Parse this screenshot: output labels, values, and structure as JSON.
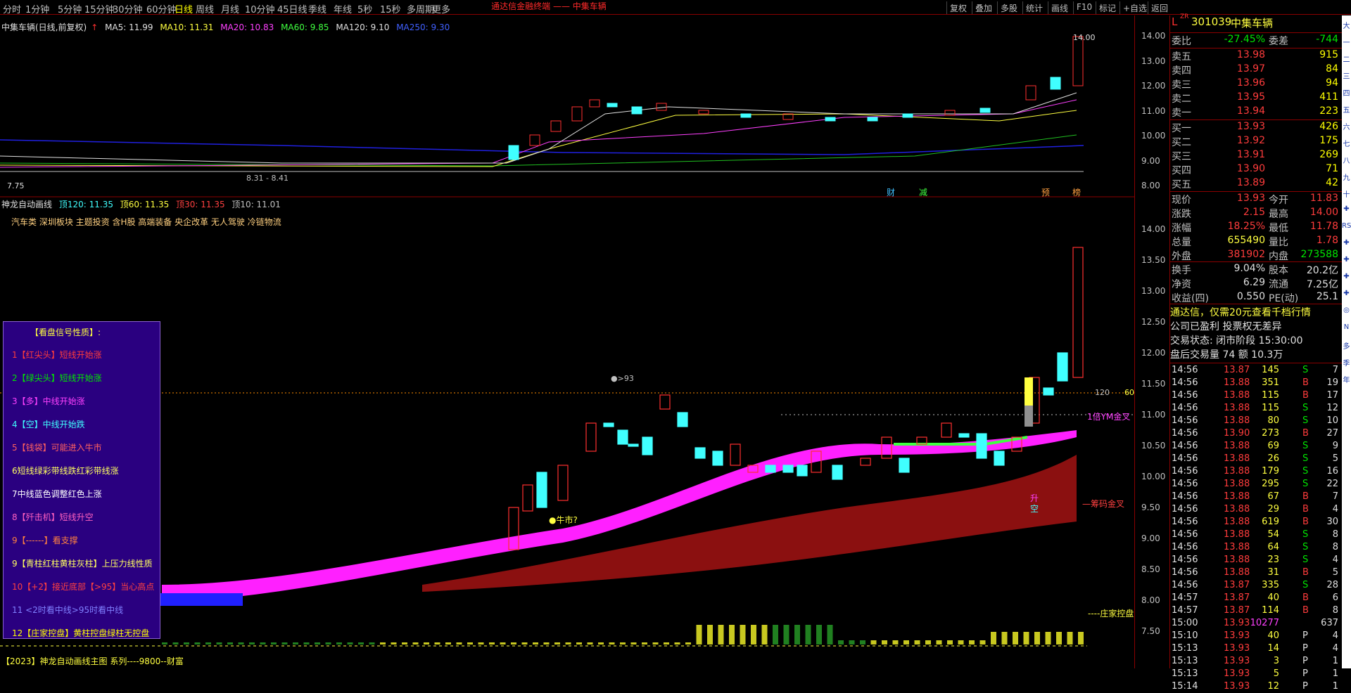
{
  "window_title": "通达信金融终端 —— 中集车辆",
  "timeframes": [
    "分时",
    "1分钟",
    "5分钟",
    "15分钟",
    "30分钟",
    "60分钟",
    "日线",
    "周线",
    "月线",
    "10分钟",
    "45日线",
    "季线",
    "年线",
    "5秒",
    "15秒",
    "多周期",
    "更多"
  ],
  "active_timeframe": "日线",
  "toolbar": [
    "复权",
    "叠加",
    "多股",
    "统计",
    "画线",
    "F10",
    "标记",
    "+自选",
    "返回"
  ],
  "stock": {
    "title": "中集车辆(日线,前复权)",
    "name": "中集车辆",
    "code": "301039",
    "badge": "ZR"
  },
  "ma": {
    "ma5": "MA5: 11.99",
    "ma10": "MA10: 11.31",
    "ma20": "MA20: 10.83",
    "ma60": "MA60: 9.85",
    "ma120": "MA120: 9.10",
    "ma250": "MA250: 9.30"
  },
  "upper_chart": {
    "high_label": "14.00",
    "low_label": "7.75",
    "range_label": "8.31 - 8.41",
    "event_marks": [
      "财",
      "减",
      "预",
      "榜"
    ]
  },
  "upper_axis": [
    "14.00",
    "13.00",
    "12.00",
    "11.00",
    "10.00",
    "9.00",
    "8.00"
  ],
  "lower_axis": [
    "14.00",
    "13.50",
    "13.00",
    "12.50",
    "12.00",
    "11.50",
    "11.00",
    "10.50",
    "10.00",
    "9.50",
    "9.00",
    "8.50",
    "8.00",
    "7.50"
  ],
  "indicator": {
    "name": "神龙自动画线",
    "vals": [
      "顶120: 11.35",
      "顶60: 11.35",
      "顶30: 11.35",
      "顶10: 11.01"
    ],
    "concepts": "汽车类 深圳板块 主题投资 含H股 高端装备 央企改革 无人驾驶 冷链物流",
    "labels": {
      "l120": "120",
      "l60": "60",
      "ym": "1倍YM金叉",
      "cm": "—筹码金叉",
      "zj": "----庄家控盘",
      "bull": "●牛市?",
      "gt93": "●>93",
      "sheng": "升",
      "kong": "空"
    }
  },
  "legend": {
    "title": "【看盘信号性质】:",
    "items": [
      {
        "t": "1【红尖头】短线开始涨",
        "c": "#ff3c3c"
      },
      {
        "t": "2【绿尖头】短线开始涨",
        "c": "#00e600"
      },
      {
        "t": "3【多】中线开始涨",
        "c": "#ff40ff"
      },
      {
        "t": "4【空】中线开始跌",
        "c": "#40ffff"
      },
      {
        "t": "5【钱袋】可能进入牛市",
        "c": "#ff6060"
      },
      {
        "t": "6短线绿彩带线跌红彩带线涨",
        "c": "#ffff60"
      },
      {
        "t": "7中线蓝色调整红色上涨",
        "c": "#ffffff"
      },
      {
        "t": "8【歼击机】短线升空",
        "c": "#ff60c0"
      },
      {
        "t": "9【------】看支撑",
        "c": "#ff8040"
      },
      {
        "t": "9【青柱红柱黄柱灰柱】上压力线性质",
        "c": "#ffff60"
      },
      {
        "t": "10【+2】接近底部【>95】当心高点",
        "c": "#ff4040"
      },
      {
        "t": "11 <2时看中线>95时看中线",
        "c": "#8080ff"
      },
      {
        "t": "12【庄家控盘】黄柱控盘绿柱无控盘",
        "c": "#ffff00"
      }
    ]
  },
  "footer": "【2023】神龙自动画线主图 系列----9800--财富",
  "quote": {
    "weibi": {
      "label": "委比",
      "value": "-27.45%",
      "label2": "委差",
      "value2": "-744"
    },
    "asks": [
      {
        "l": "卖五",
        "p": "13.98",
        "v": "915"
      },
      {
        "l": "卖四",
        "p": "13.97",
        "v": "84"
      },
      {
        "l": "卖三",
        "p": "13.96",
        "v": "94"
      },
      {
        "l": "卖二",
        "p": "13.95",
        "v": "411"
      },
      {
        "l": "卖一",
        "p": "13.94",
        "v": "223"
      }
    ],
    "bids": [
      {
        "l": "买一",
        "p": "13.93",
        "v": "426"
      },
      {
        "l": "买二",
        "p": "13.92",
        "v": "175"
      },
      {
        "l": "买三",
        "p": "13.91",
        "v": "269"
      },
      {
        "l": "买四",
        "p": "13.90",
        "v": "71"
      },
      {
        "l": "买五",
        "p": "13.89",
        "v": "42"
      }
    ],
    "stats": [
      {
        "l": "现价",
        "v": "13.93",
        "l2": "今开",
        "v2": "11.83"
      },
      {
        "l": "涨跌",
        "v": "2.15",
        "l2": "最高",
        "v2": "14.00"
      },
      {
        "l": "涨幅",
        "v": "18.25%",
        "l2": "最低",
        "v2": "11.78"
      },
      {
        "l": "总量",
        "v": "655490",
        "l2": "量比",
        "v2": "1.78"
      },
      {
        "l": "外盘",
        "v": "381902",
        "l2": "内盘",
        "v2": "273588"
      }
    ],
    "stats2": [
      {
        "l": "换手",
        "v": "9.04%",
        "l2": "股本",
        "v2": "20.2亿"
      },
      {
        "l": "净资",
        "v": "6.29",
        "l2": "流通",
        "v2": "7.25亿"
      },
      {
        "l": "收益(四)",
        "v": "0.550",
        "l2": "PE(动)",
        "v2": "25.1"
      }
    ],
    "ad": "通达信，仅需20元查看千档行情",
    "info1": "公司已盈利 投票权无差异",
    "info2": "交易状态: 闭市阶段 15:30:00",
    "info3": "盘后交易量 74 额 10.3万"
  },
  "ticks": [
    [
      "14:56",
      "13.87",
      "145",
      "S",
      "7"
    ],
    [
      "14:56",
      "13.88",
      "351",
      "B",
      "19"
    ],
    [
      "14:56",
      "13.88",
      "115",
      "B",
      "17"
    ],
    [
      "14:56",
      "13.88",
      "115",
      "S",
      "12"
    ],
    [
      "14:56",
      "13.88",
      "80",
      "S",
      "10"
    ],
    [
      "14:56",
      "13.90",
      "273",
      "B",
      "27"
    ],
    [
      "14:56",
      "13.88",
      "69",
      "S",
      "9"
    ],
    [
      "14:56",
      "13.88",
      "26",
      "S",
      "5"
    ],
    [
      "14:56",
      "13.88",
      "179",
      "S",
      "16"
    ],
    [
      "14:56",
      "13.88",
      "295",
      "S",
      "22"
    ],
    [
      "14:56",
      "13.88",
      "67",
      "B",
      "7"
    ],
    [
      "14:56",
      "13.88",
      "29",
      "B",
      "4"
    ],
    [
      "14:56",
      "13.88",
      "619",
      "B",
      "30"
    ],
    [
      "14:56",
      "13.88",
      "54",
      "S",
      "8"
    ],
    [
      "14:56",
      "13.88",
      "64",
      "S",
      "8"
    ],
    [
      "14:56",
      "13.88",
      "23",
      "S",
      "4"
    ],
    [
      "14:56",
      "13.88",
      "31",
      "B",
      "5"
    ],
    [
      "14:56",
      "13.87",
      "335",
      "S",
      "28"
    ],
    [
      "14:57",
      "13.87",
      "40",
      "B",
      "6"
    ],
    [
      "14:57",
      "13.87",
      "114",
      "B",
      "8"
    ],
    [
      "15:00",
      "13.93",
      "10277",
      "",
      "637"
    ],
    [
      "15:10",
      "13.93",
      "40",
      "P",
      "4"
    ],
    [
      "15:13",
      "13.93",
      "14",
      "P",
      "4"
    ],
    [
      "15:13",
      "13.93",
      "3",
      "P",
      "1"
    ],
    [
      "15:13",
      "13.93",
      "5",
      "P",
      "1"
    ],
    [
      "15:14",
      "13.93",
      "12",
      "P",
      "1"
    ]
  ],
  "side_tools": [
    "大",
    "一",
    "二",
    "三",
    "四",
    "五",
    "六",
    "七",
    "八",
    "九",
    "十",
    "✚",
    "RSI",
    "✚",
    "✚",
    "✚",
    "✚",
    "◎",
    "N",
    "多",
    "季",
    "年"
  ]
}
